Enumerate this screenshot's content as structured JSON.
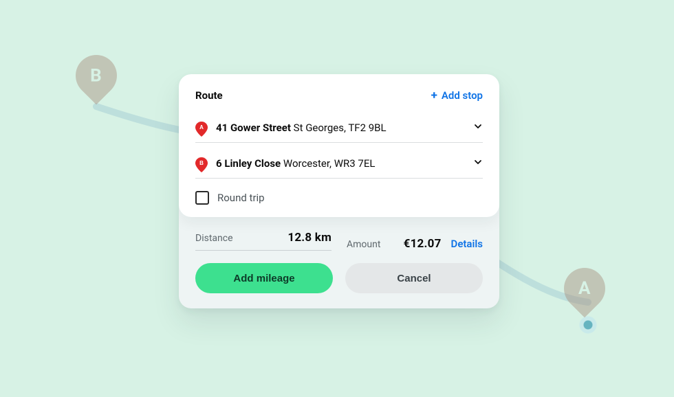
{
  "header": {
    "title": "Route",
    "add_stop_label": "Add stop"
  },
  "stops": [
    {
      "letter": "A",
      "street": "41 Gower Street",
      "rest": "St Georges, TF2 9BL"
    },
    {
      "letter": "B",
      "street": "6 Linley Close",
      "rest": "Worcester, WR3 7EL"
    }
  ],
  "round_trip": {
    "label": "Round trip",
    "checked": false
  },
  "totals": {
    "distance_label": "Distance",
    "distance_value": "12.8 km",
    "amount_label": "Amount",
    "amount_value": "€12.07",
    "details_label": "Details"
  },
  "actions": {
    "primary": "Add mileage",
    "secondary": "Cancel"
  },
  "map_bg": {
    "pin_a_label": "A",
    "pin_b_label": "B"
  },
  "colors": {
    "bg": "#d7f2e5",
    "link": "#0f73e6",
    "primary_btn": "#3de08f",
    "pin": "#e2292a"
  }
}
